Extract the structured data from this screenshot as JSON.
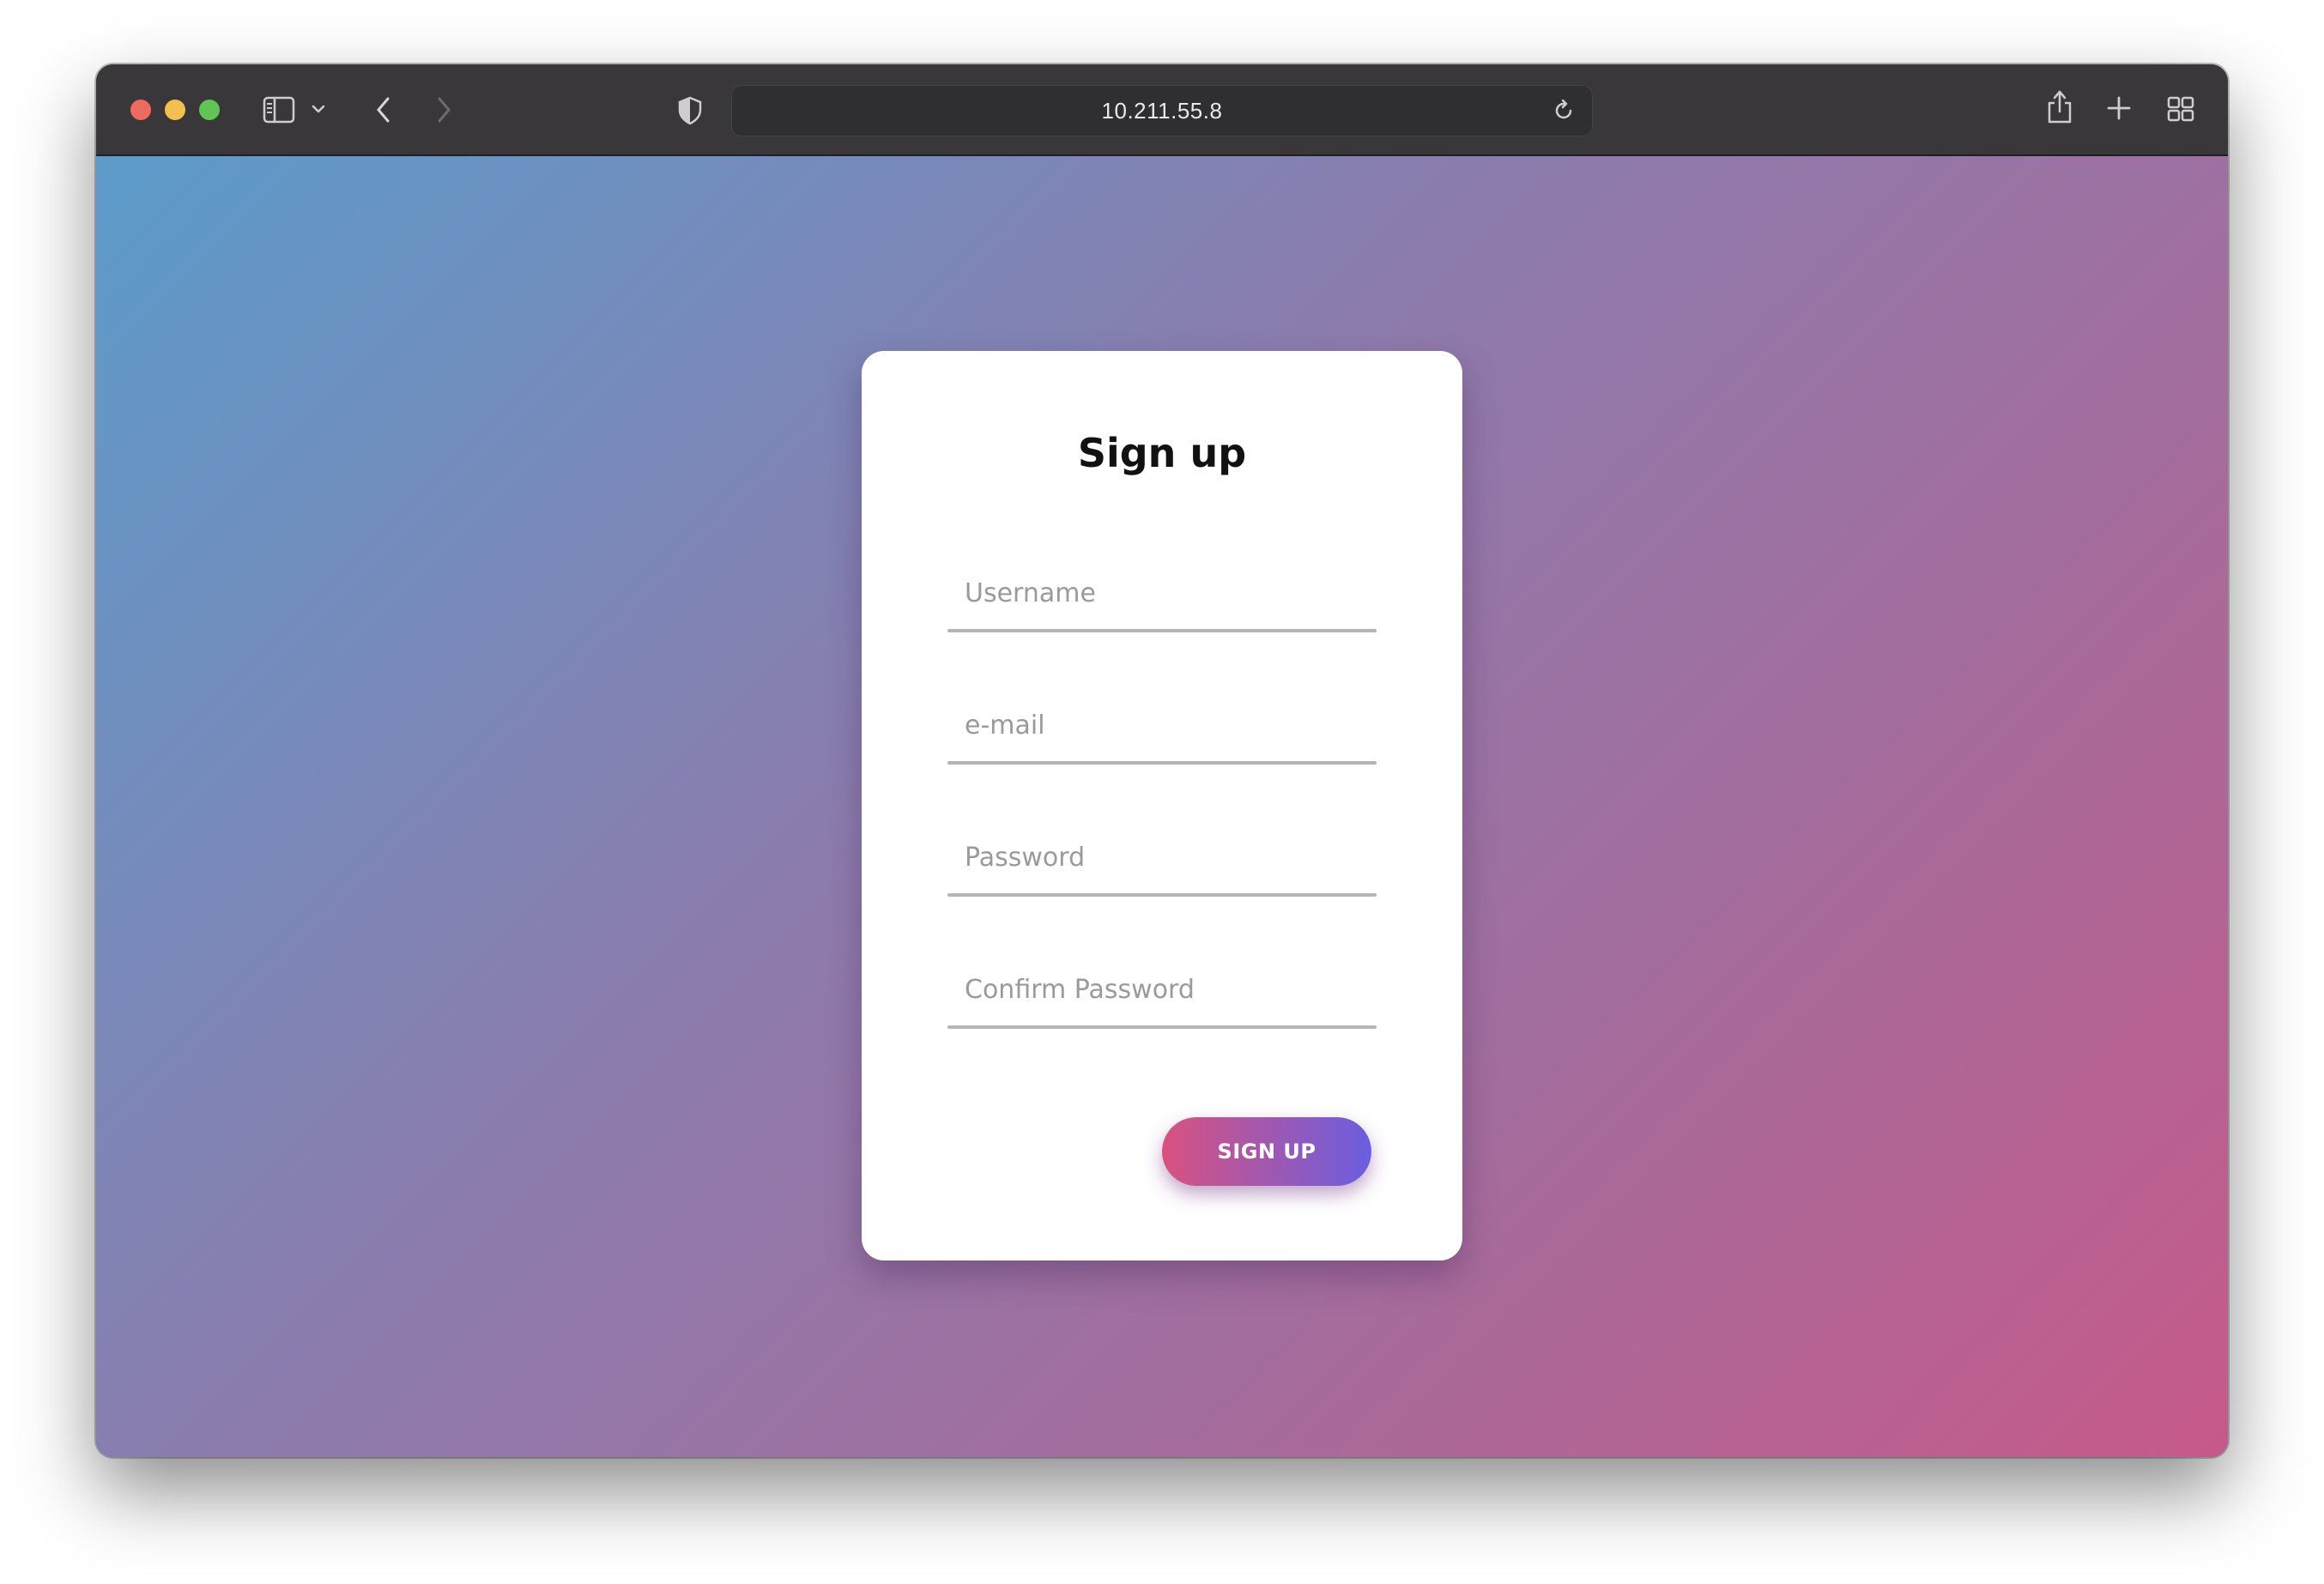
{
  "browser": {
    "url": "10.211.55.8",
    "icons": {
      "sidebar": "sidebar-icon",
      "sidebar_menu": "chevron-down-icon",
      "back": "chevron-left-icon",
      "forward": "chevron-right-icon",
      "privacy": "shield-icon",
      "reload": "reload-icon",
      "share": "share-icon",
      "new_tab": "plus-icon",
      "tab_overview": "grid-icon"
    }
  },
  "page": {
    "background_gradient": [
      "#5c9ccb",
      "#8a7dae",
      "#c65a8a"
    ],
    "form": {
      "title": "Sign up",
      "fields": {
        "username": {
          "placeholder": "Username",
          "value": ""
        },
        "email": {
          "placeholder": "e-mail",
          "value": ""
        },
        "password": {
          "placeholder": "Password",
          "value": ""
        },
        "confirm_password": {
          "placeholder": "Confirm Password",
          "value": ""
        }
      },
      "submit_label": "SIGN UP",
      "submit_gradient": [
        "#d9527f",
        "#6a5ee0"
      ]
    }
  }
}
